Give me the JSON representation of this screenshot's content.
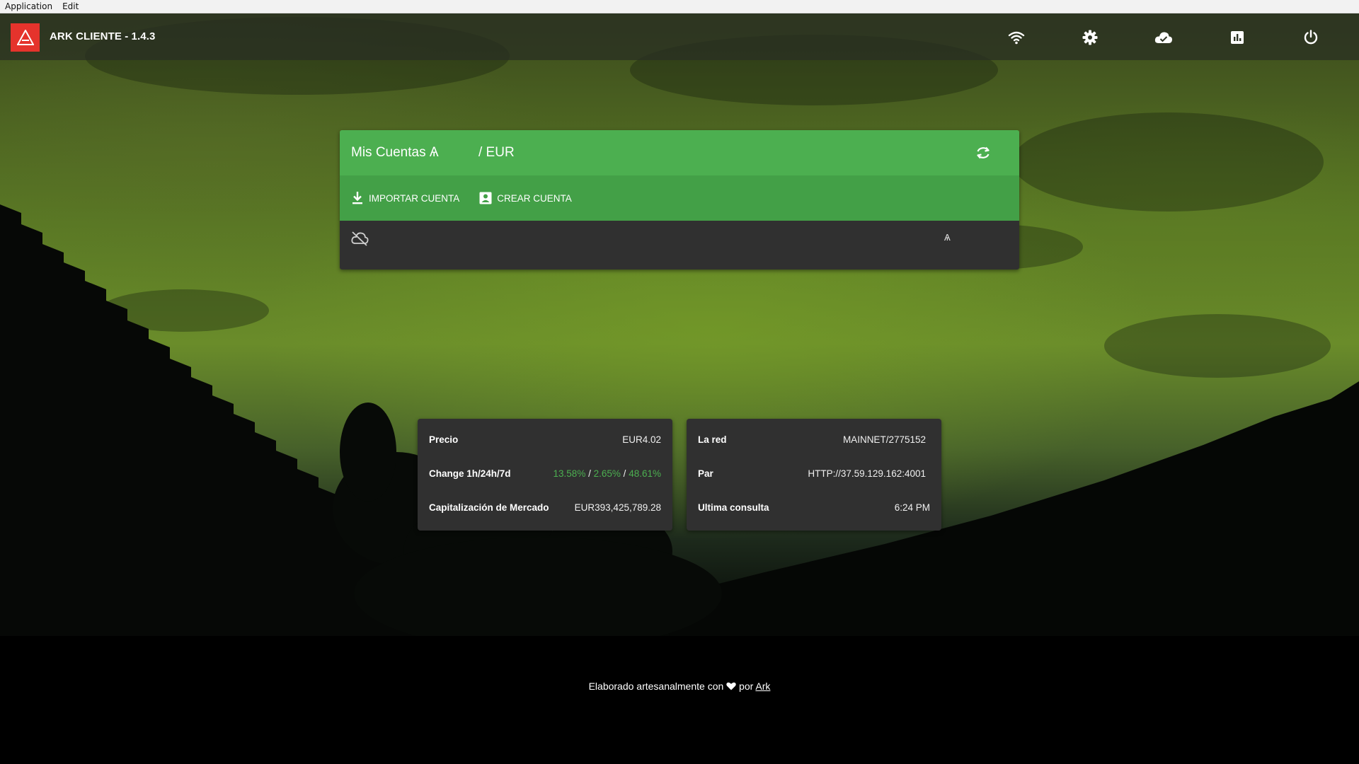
{
  "menubar": {
    "items": [
      "Application",
      "Edit"
    ]
  },
  "app": {
    "title": "ARK CLIENTE - 1.4.3",
    "brand_color": "#e5332c"
  },
  "topbar_icons": [
    "wifi-icon",
    "settings-icon",
    "cloud-icon",
    "chart-icon",
    "power-icon"
  ],
  "accounts": {
    "title": "Mis Cuentas Ѧ",
    "currency": "/ EUR",
    "import_label": "IMPORTAR CUENTA",
    "create_label": "CREAR CUENTA",
    "balance_symbol": "Ѧ",
    "header_color": "#4caf50",
    "toolbar_color": "#43a047"
  },
  "market": {
    "price_label": "Precio",
    "price_value": "EUR4.02",
    "change_label": "Change 1h/24h/7d",
    "change_1h": "13.58%",
    "change_24h": "2.65%",
    "change_7d": "48.61%",
    "separator": "/",
    "market_cap_label": "Capitalización de Mercado",
    "market_cap_value": "EUR393,425,789.28"
  },
  "network": {
    "network_label": "La red",
    "network_value": "MAINNET/2775152",
    "peer_label": "Par",
    "peer_value": "HTTP://37.59.129.162:4001",
    "last_check_label": "Ultima consulta",
    "last_check_value": "6:24 PM"
  },
  "footer": {
    "prefix": "Elaborado artesanalmente con",
    "middle": "por",
    "link": "Ark"
  }
}
